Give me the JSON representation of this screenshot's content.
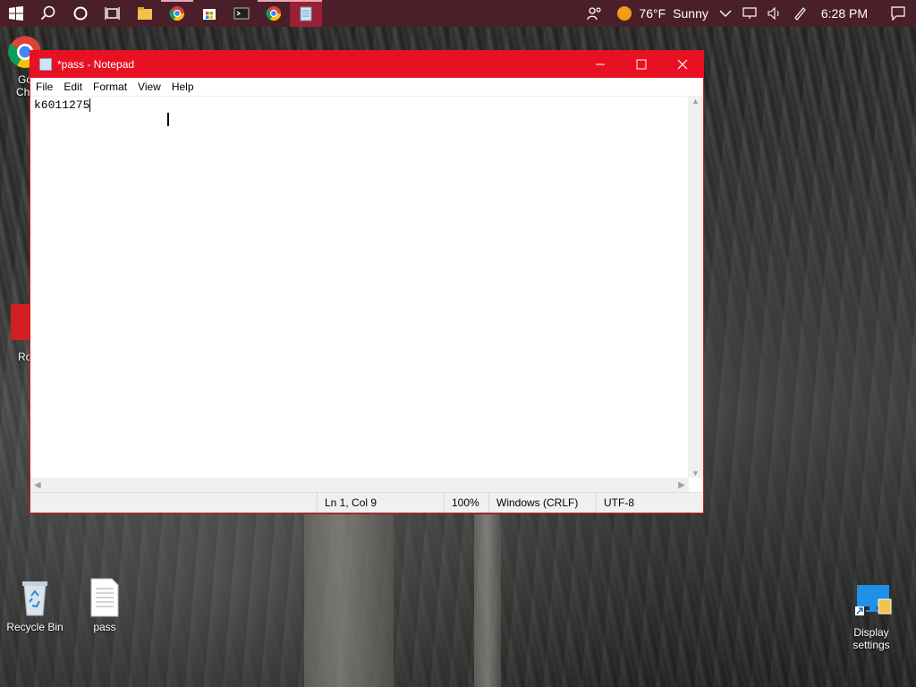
{
  "taskbar": {
    "start_icon": "windows-logo-icon",
    "search_icon": "search-icon",
    "cortana_icon": "cortana-circle-icon",
    "taskview_icon": "task-view-icon",
    "apps": [
      {
        "name": "file-explorer-icon"
      },
      {
        "name": "chrome-icon"
      },
      {
        "name": "store-icon"
      },
      {
        "name": "terminal-icon"
      },
      {
        "name": "chrome-profile-icon"
      },
      {
        "name": "notepad-icon"
      }
    ],
    "tray": {
      "weather_temp": "76°F",
      "weather_desc": "Sunny",
      "time": "6:28 PM"
    }
  },
  "desktop": {
    "icons": [
      {
        "label": "Recycle Bin"
      },
      {
        "label": "pass"
      },
      {
        "label": "Display settings"
      }
    ],
    "partial_labels": [
      "Go",
      "Ch",
      "Ro"
    ]
  },
  "notepad": {
    "title": "*pass - Notepad",
    "menu": [
      "File",
      "Edit",
      "Format",
      "View",
      "Help"
    ],
    "content": "k6011275",
    "status": {
      "position": "Ln 1, Col 9",
      "zoom": "100%",
      "line_endings": "Windows (CRLF)",
      "encoding": "UTF-8"
    }
  },
  "colors": {
    "accent": "#e81123",
    "taskbar": "#4a1f2a"
  }
}
